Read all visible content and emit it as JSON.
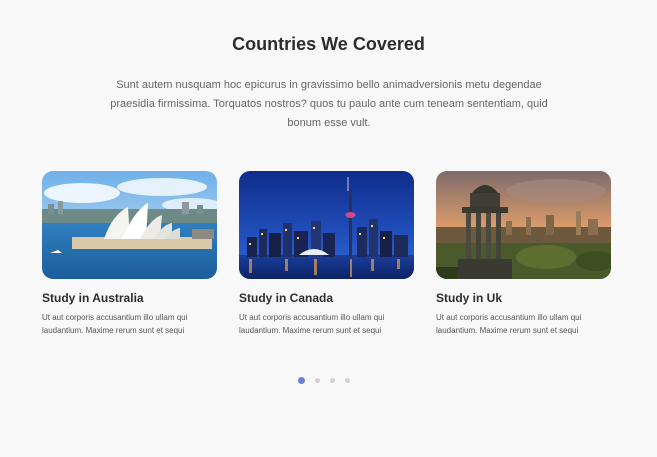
{
  "section": {
    "title": "Countries We Covered",
    "description": "Sunt autem nusquam hoc epicurus in gravissimo bello animadversionis metu degendae praesidia firmissima. Torquatos nostros? quos tu paulo ante cum teneam sententiam, quid bonum esse vult."
  },
  "cards": [
    {
      "title": "Study in Australia",
      "text": "Ut aut corporis accusantium illo ullam qui laudantium. Maxime rerum sunt et sequi",
      "image": "sydney-opera-house-photo"
    },
    {
      "title": "Study in Canada",
      "text": "Ut aut corporis accusantium illo ullam qui laudantium. Maxime rerum sunt et sequi",
      "image": "toronto-skyline-photo"
    },
    {
      "title": "Study in Uk",
      "text": "Ut aut corporis accusantium illo ullam qui laudantium. Maxime rerum sunt et sequi",
      "image": "edinburgh-monument-photo"
    }
  ],
  "carousel": {
    "dot_count": 4,
    "active_index": 0
  },
  "colors": {
    "accent": "#6b80dc",
    "dot_inactive": "#cfcfd4",
    "background": "#f8f8f9"
  }
}
